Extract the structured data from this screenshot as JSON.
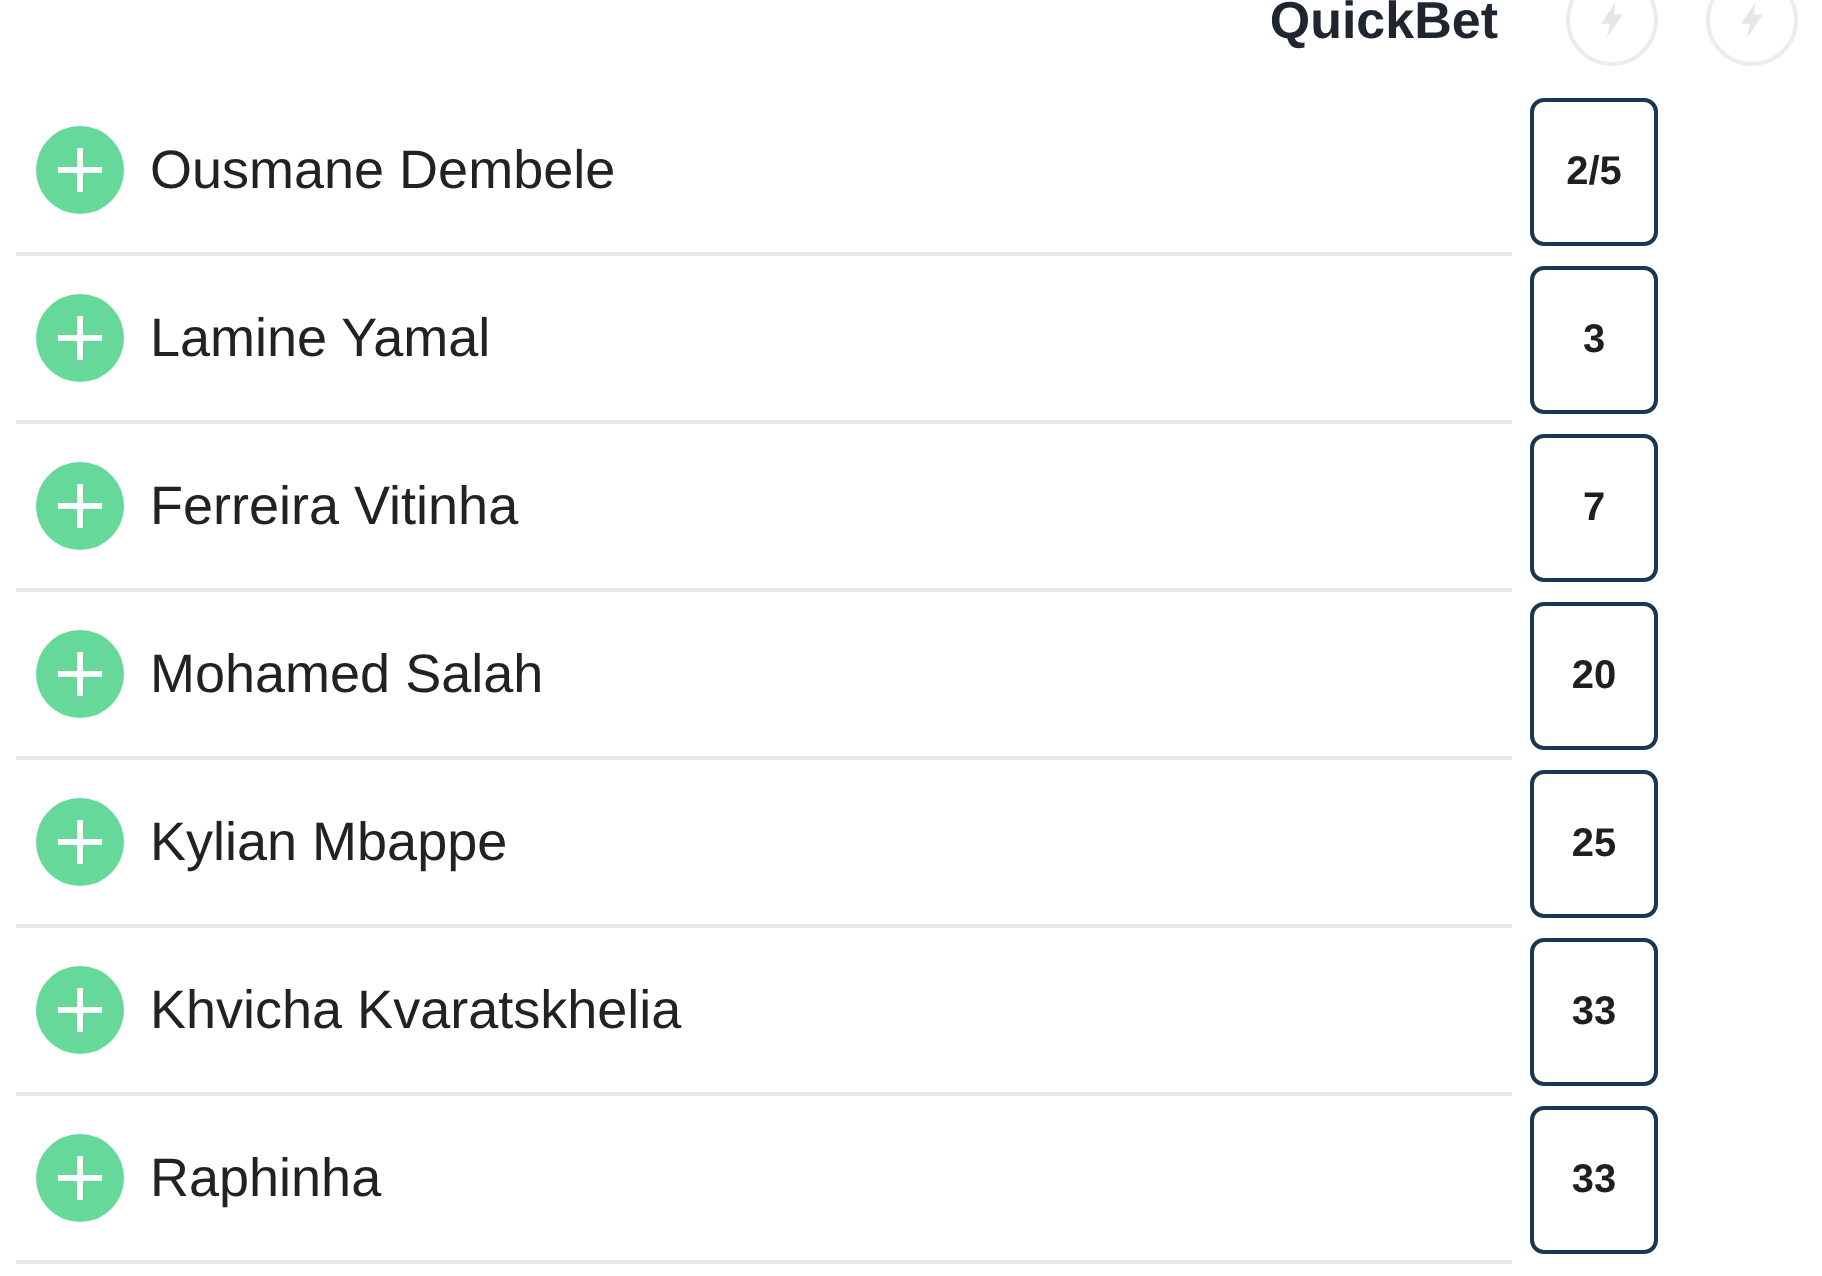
{
  "header": {
    "title": "QuickBet",
    "quickbet_toggles": [
      {
        "on": false
      },
      {
        "on": false
      }
    ]
  },
  "selections": [
    {
      "name": "Ousmane Dembele",
      "odds": "2/5"
    },
    {
      "name": "Lamine Yamal",
      "odds": "3"
    },
    {
      "name": "Ferreira Vitinha",
      "odds": "7"
    },
    {
      "name": "Mohamed Salah",
      "odds": "20"
    },
    {
      "name": "Kylian Mbappe",
      "odds": "25"
    },
    {
      "name": "Khvicha Kvaratskhelia",
      "odds": "33"
    },
    {
      "name": "Raphinha",
      "odds": "33"
    }
  ]
}
